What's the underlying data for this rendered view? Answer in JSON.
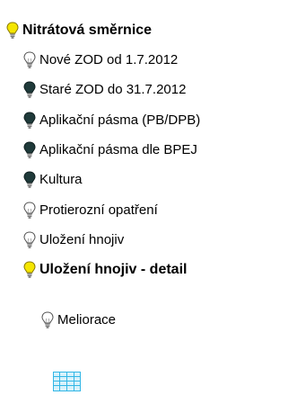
{
  "tree": {
    "root": {
      "label": "Nitrátová směrnice",
      "icon": "bulb-on-icon"
    },
    "items": [
      {
        "label": "Nové ZOD od 1.7.2012",
        "icon": "bulb-off-icon"
      },
      {
        "label": "Staré ZOD do 31.7.2012",
        "icon": "bulb-dark-icon"
      },
      {
        "label": "Aplikační pásma (PB/DPB)",
        "icon": "bulb-dark-icon"
      },
      {
        "label": "Aplikační pásma dle BPEJ",
        "icon": "bulb-dark-icon"
      },
      {
        "label": "Kultura",
        "icon": "bulb-dark-icon"
      },
      {
        "label": "Protierozní opatření",
        "icon": "bulb-off-icon"
      },
      {
        "label": "Uložení hnojiv",
        "icon": "bulb-off-icon"
      },
      {
        "label": "Uložení hnojiv - detail",
        "icon": "bulb-on-icon"
      }
    ],
    "sub_items": [
      {
        "label": "Meliorace",
        "icon": "bulb-off-icon"
      }
    ],
    "legend_icon": "table-grid-icon"
  },
  "colors": {
    "bulb_on": "#f5e600",
    "bulb_off": "#ffffff",
    "bulb_dark": "#1f3a3a",
    "outline": "#555555",
    "grid_fill": "#d8f2fb",
    "grid_line": "#33b7e6"
  }
}
